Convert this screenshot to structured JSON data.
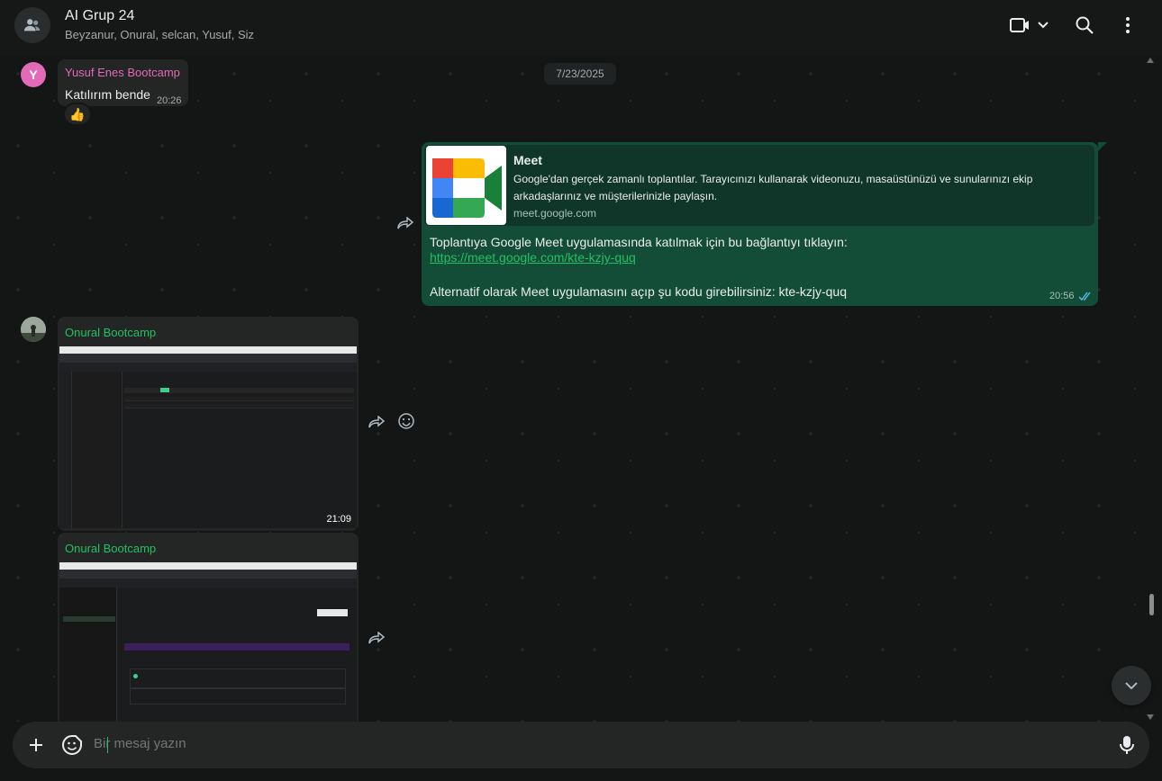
{
  "header": {
    "title": "AI Grup 24",
    "members": "Beyzanur, Onural, selcan, Yusuf, Siz"
  },
  "chat": {
    "date_chip": "7/23/2025",
    "messages": [
      {
        "sender_initial": "Y",
        "sender": "Yusuf Enes Bootcamp",
        "text": "Katılırım bende",
        "time": "20:26",
        "reaction": "👍",
        "sender_color": "#e26ab6"
      },
      {
        "link_title": "Meet",
        "link_desc": "Google'dan gerçek zamanlı toplantılar. Tarayıcınızı kullanarak videonuzu, masaüstünüzü ve sunularınızı ekip arkadaşlarınız ve müşterilerinizle paylaşın.",
        "link_domain": "meet.google.com",
        "line1": "Toplantıya Google Meet uygulamasında katılmak için bu bağlantıyı tıklayın:",
        "link": "https://meet.google.com/kte-kzjy-quq",
        "line2": "Alternatif olarak Meet uygulamasını açıp şu kodu girebilirsiniz: kte-kzjy-quq",
        "time": "20:56"
      },
      {
        "sender": "Onural Bootcamp",
        "time": "21:09",
        "sender_color": "#21c063"
      },
      {
        "sender": "Onural Bootcamp",
        "sender_color": "#21c063"
      }
    ]
  },
  "composer": {
    "placeholder": "Bir mesaj yazın"
  },
  "colors": {
    "accent": "#21c063",
    "outgoing_bubble": "#144d37",
    "incoming_bubble": "#242626"
  }
}
